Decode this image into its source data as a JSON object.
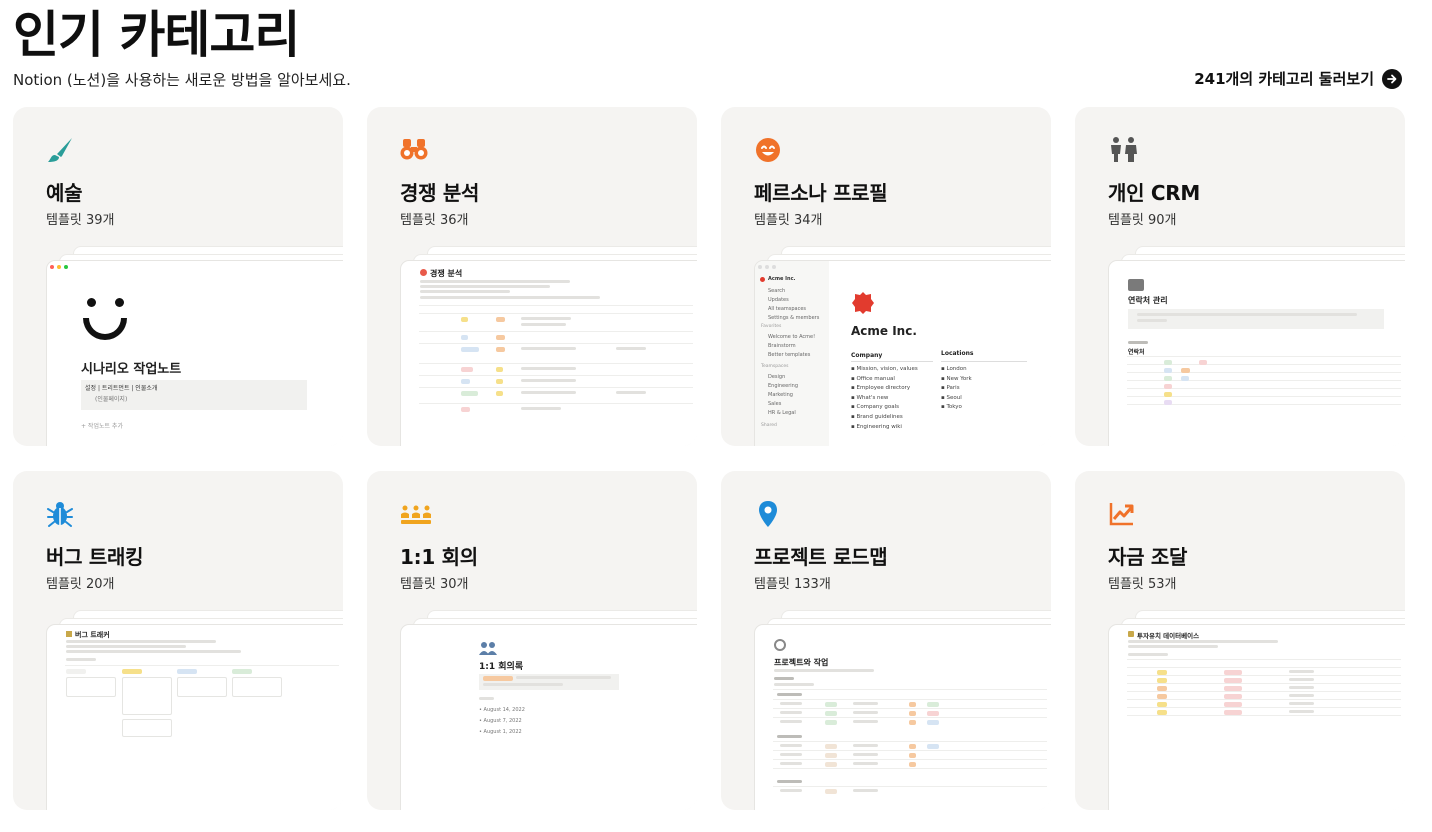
{
  "header": {
    "title": "인기 카테고리",
    "subtitle": "Notion (노션)을 사용하는 새로운 방법을 알아보세요.",
    "browse_label": "241개의 카테고리 둘러보기"
  },
  "colors": {
    "teal": "#2a9d99",
    "orange": "#f0722a",
    "gray": "#555555",
    "blue": "#1e8bd8",
    "card_bg": "#f5f4f2"
  },
  "cards": [
    {
      "title": "예술",
      "count": "템플릿 39개",
      "icon": "paintbrush-icon",
      "preview": {
        "heading": "시나리오 작업노트",
        "row1": "설정 | 트리트먼트 | 인물소개",
        "row2": "(인물페이지)",
        "add": "+ 작업노트 추가"
      }
    },
    {
      "title": "경쟁 분석",
      "count": "템플릿 36개",
      "icon": "binoculars-icon",
      "preview": {
        "heading": "경쟁 분석"
      }
    },
    {
      "title": "페르소나 프로필",
      "count": "템플릿 34개",
      "icon": "smiley-face-icon",
      "preview": {
        "workspace": "Acme Inc.",
        "nav": [
          "Search",
          "Updates",
          "All teamspaces",
          "Settings & members"
        ],
        "favorites_label": "Favorites",
        "favorites": [
          "Welcome to Acme!",
          "Brainstorm",
          "Better templates"
        ],
        "teamspaces_label": "Teamspaces",
        "teamspaces": [
          "Design",
          "Engineering",
          "Marketing",
          "Sales",
          "HR & Legal"
        ],
        "shared_label": "Shared",
        "company_label": "Company",
        "company_items": [
          "Mission, vision, values",
          "Office manual",
          "Employee directory",
          "What's new",
          "Company goals",
          "Brand guidelines",
          "Engineering wiki"
        ],
        "locations_label": "Locations",
        "locations": [
          "London",
          "New York",
          "Paris",
          "Seoul",
          "Tokyo"
        ]
      }
    },
    {
      "title": "개인 CRM",
      "count": "템플릿 90개",
      "icon": "people-icon",
      "preview": {
        "heading": "연락처 관리",
        "sub": "연락처"
      }
    },
    {
      "title": "버그 트래킹",
      "count": "템플릿 20개",
      "icon": "bug-icon",
      "preview": {
        "heading": "버그 트래커"
      }
    },
    {
      "title": "1:1 회의",
      "count": "템플릿 30개",
      "icon": "group-icon",
      "preview": {
        "heading": "1:1 회의록",
        "items": [
          "August 14, 2022",
          "August 7, 2022",
          "August 1, 2022"
        ]
      }
    },
    {
      "title": "프로젝트 로드맵",
      "count": "템플릿 133개",
      "icon": "map-pin-icon",
      "preview": {
        "heading": "프로젝트와 작업"
      }
    },
    {
      "title": "자금 조달",
      "count": "템플릿 53개",
      "icon": "chart-up-icon",
      "preview": {
        "heading": "투자유치 데이터베이스"
      }
    }
  ]
}
